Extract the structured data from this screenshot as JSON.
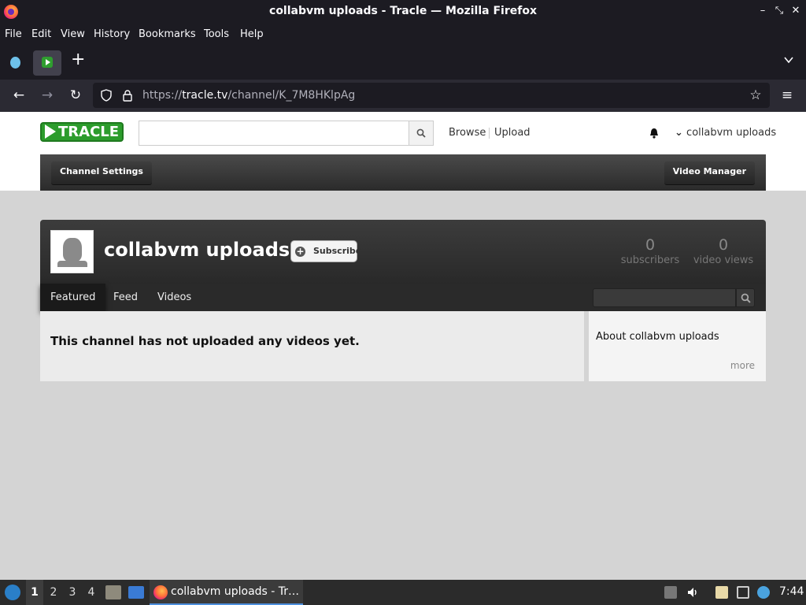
{
  "window": {
    "title": "collabvm uploads - Tracle — Mozilla Firefox"
  },
  "menu": {
    "items": [
      "File",
      "Edit",
      "View",
      "History",
      "Bookmarks",
      "Tools",
      "Help"
    ]
  },
  "urlbar": {
    "url_prefix": "https://",
    "url_domain": "tracle.tv",
    "url_path": "/channel/K_7M8HKlpAg"
  },
  "site": {
    "logo_text": "TRACLE",
    "search_placeholder": "",
    "nav_browse": "Browse",
    "nav_upload": "Upload",
    "account_name": "collabvm uploads",
    "channel_settings": "Channel Settings",
    "video_manager": "Video Manager"
  },
  "channel": {
    "name": "collabvm uploads",
    "subscribe_label": "Subscribe",
    "subscribers_count": "0",
    "subscribers_label": "subscribers",
    "views_count": "0",
    "views_label": "video views",
    "tabs": [
      "Featured",
      "Feed",
      "Videos"
    ],
    "active_tab": "Featured",
    "empty_message": "This channel has not uploaded any videos yet.",
    "about_title": "About collabvm uploads",
    "more_label": "more"
  },
  "taskbar": {
    "workspaces": [
      "1",
      "2",
      "3",
      "4"
    ],
    "active_workspace": "1",
    "task_label": "collabvm uploads - Tr…",
    "clock": "7:44"
  },
  "colors": {
    "brand_green": "#2c9c2c",
    "firefox_chrome": "#1c1b22",
    "channel_dark": "#2a2a2a"
  }
}
